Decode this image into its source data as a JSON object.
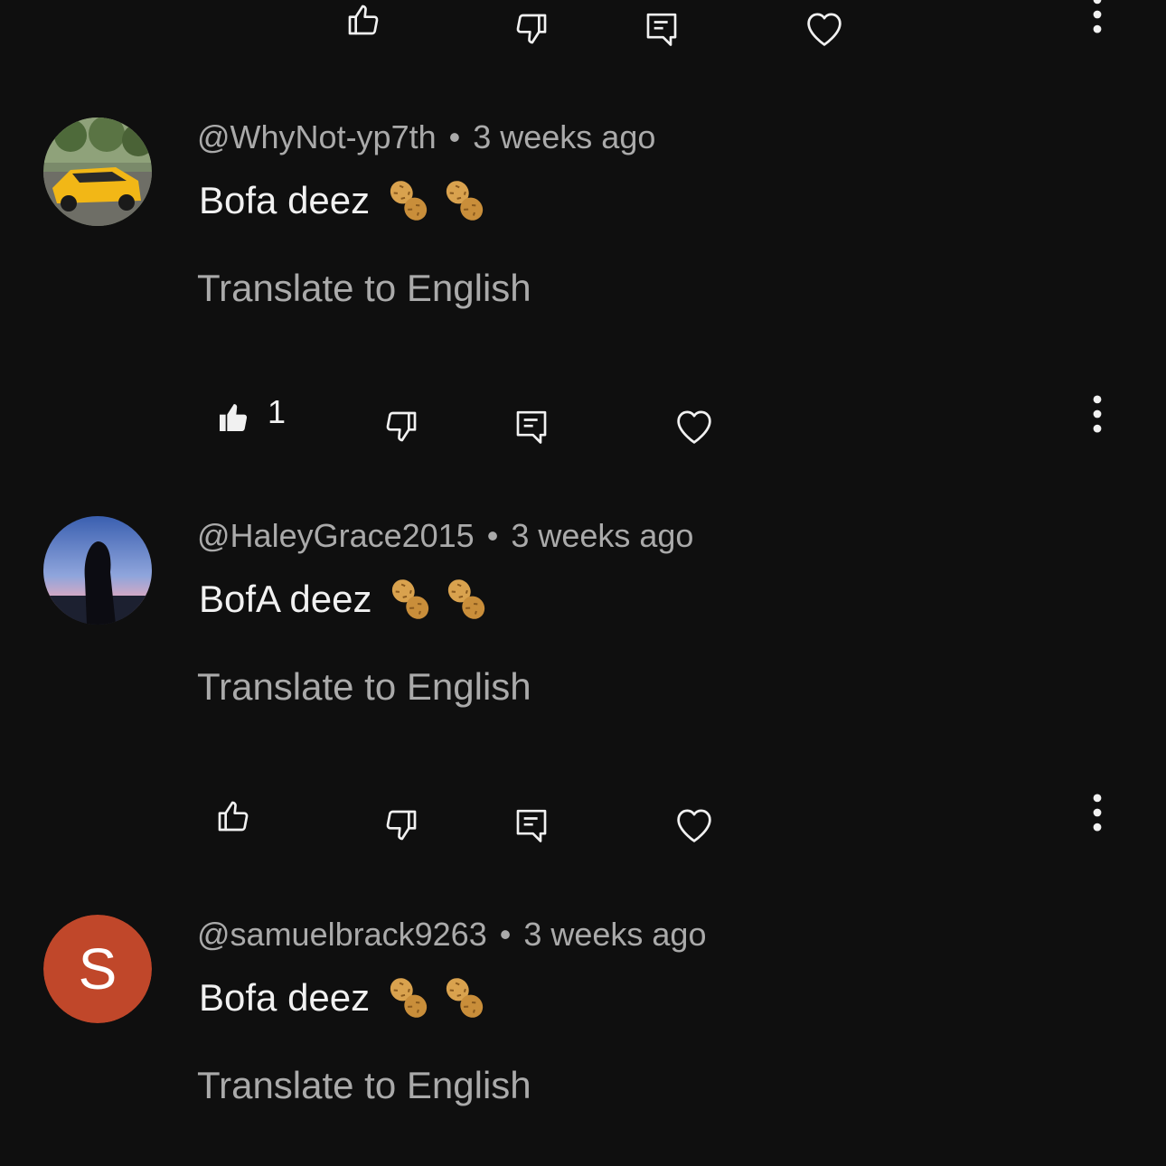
{
  "top_actions": {
    "like_count": ""
  },
  "comments": [
    {
      "username": "@WhyNot-yp7th",
      "separator": "•",
      "time": "3 weeks ago",
      "text": "Bofa deez",
      "emoji": "peanut-emoji",
      "translate_label": "Translate to English",
      "like_count": "1",
      "avatar": "yellow-car-photo"
    },
    {
      "username": "@HaleyGrace2015",
      "separator": "•",
      "time": "3 weeks ago",
      "text": "BofA deez",
      "emoji": "peanut-emoji",
      "translate_label": "Translate to English",
      "like_count": "",
      "avatar": "silhouette-photo"
    },
    {
      "username": "@samuelbrack9263",
      "separator": "•",
      "time": "3 weeks ago",
      "text": "Bofa deez",
      "emoji": "peanut-emoji",
      "translate_label": "Translate to English",
      "avatar_letter": "S",
      "avatar_color": "#c0472a"
    }
  ],
  "icons": {
    "like": "thumbs-up-icon",
    "dislike": "thumbs-down-icon",
    "reply": "reply-icon",
    "heart": "heart-icon",
    "more": "more-vertical-icon"
  },
  "colors": {
    "background": "#0f0f0f",
    "primary_text": "#f1f1f1",
    "secondary_text": "#aaaaaa"
  }
}
